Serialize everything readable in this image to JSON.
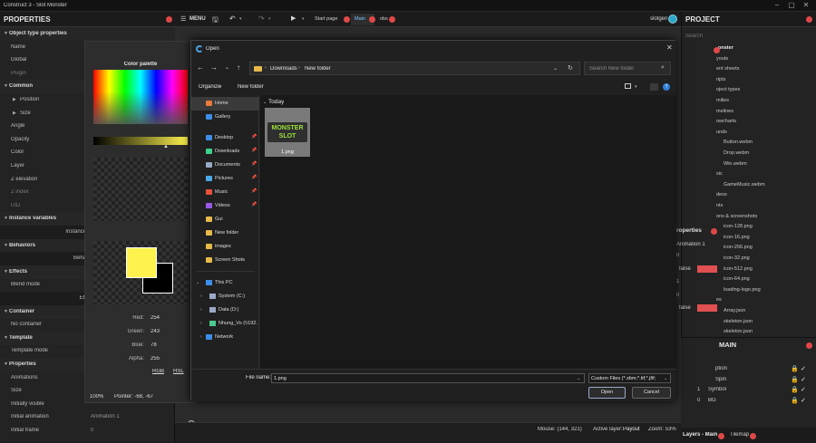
{
  "window": {
    "title": "Construct 3 - Slot Monster"
  },
  "properties": {
    "title": "PROPERTIES",
    "rows": [
      {
        "label": "Object type properties",
        "kind": "sec"
      },
      {
        "label": "Name",
        "kind": "row"
      },
      {
        "label": "Global",
        "kind": "row"
      },
      {
        "label": "Plugin",
        "kind": "dim"
      },
      {
        "label": "Common",
        "kind": "sec"
      },
      {
        "label": "Position",
        "kind": "ind"
      },
      {
        "label": "Size",
        "kind": "ind"
      },
      {
        "label": "Angle",
        "kind": "row"
      },
      {
        "label": "Opacity",
        "kind": "row"
      },
      {
        "label": "Color",
        "kind": "row"
      },
      {
        "label": "Layer",
        "kind": "row"
      },
      {
        "label": "Z elevation",
        "kind": "row"
      },
      {
        "label": "Z index",
        "kind": "dim"
      },
      {
        "label": "UID",
        "kind": "dim"
      },
      {
        "label": "Instance variables",
        "kind": "sec"
      },
      {
        "label": "Instance",
        "kind": "btn"
      },
      {
        "label": "Behaviors",
        "kind": "sec"
      },
      {
        "label": "Beha",
        "kind": "btn"
      },
      {
        "label": "Effects",
        "kind": "sec"
      },
      {
        "label": "Blend mode",
        "kind": "row"
      },
      {
        "label": "Eff",
        "kind": "btn"
      },
      {
        "label": "Container",
        "kind": "sec"
      },
      {
        "label": "No container",
        "kind": "row"
      },
      {
        "label": "Template",
        "kind": "sec"
      },
      {
        "label": "Template mode",
        "kind": "row"
      },
      {
        "label": "Properties",
        "kind": "sec"
      },
      {
        "label": "Animations",
        "kind": "row"
      },
      {
        "label": "Size",
        "kind": "row"
      },
      {
        "label": "Initially visible",
        "kind": "row"
      },
      {
        "label": "Initial animation",
        "kind": "row"
      },
      {
        "label": "Initial frame",
        "kind": "row"
      }
    ],
    "initial_animation_value": "Animation 1",
    "initial_frame_value": "0"
  },
  "toolbar": {
    "menu_label": "MENU",
    "tabs": [
      {
        "label": "Start page"
      },
      {
        "label": "Main"
      },
      {
        "label": "obs"
      }
    ],
    "user": "slotgen"
  },
  "palette": {
    "title": "Color palette",
    "fg_color": "#fef34e",
    "bg_color": "#000000",
    "red_label": "Red:",
    "red": "254",
    "green_label": "Green:",
    "green": "243",
    "blue_label": "Blue:",
    "blue": "78",
    "alpha_label": "Alpha:",
    "alpha": "255",
    "mode_rgb": "RGB",
    "mode_hsl": "HSL",
    "zoom": "100%",
    "pointer": "Pointer: -68, -67"
  },
  "dialog": {
    "title": "Open",
    "breadcrumb": [
      "Downloads",
      "New folder"
    ],
    "search_placeholder": "Search New folder",
    "organize": "Organize",
    "new_folder": "New folder",
    "nav_items": [
      {
        "label": "Home",
        "icon": "home-icon",
        "pinned": false,
        "selected": true
      },
      {
        "label": "Gallery",
        "icon": "gallery-icon",
        "pinned": false
      },
      {
        "label": "Desktop",
        "icon": "desktop-icon",
        "pinned": true
      },
      {
        "label": "Downloads",
        "icon": "downloads-icon",
        "pinned": true
      },
      {
        "label": "Documents",
        "icon": "documents-icon",
        "pinned": true
      },
      {
        "label": "Pictures",
        "icon": "pictures-icon",
        "pinned": true
      },
      {
        "label": "Music",
        "icon": "music-icon",
        "pinned": true
      },
      {
        "label": "Videos",
        "icon": "videos-icon",
        "pinned": true
      },
      {
        "label": "Gui",
        "icon": "folder-icon",
        "pinned": false
      },
      {
        "label": "New folder",
        "icon": "folder-icon",
        "pinned": false
      },
      {
        "label": "images",
        "icon": "folder-icon",
        "pinned": false
      },
      {
        "label": "Screen Shots",
        "icon": "folder-icon",
        "pinned": false
      }
    ],
    "tree_items": [
      {
        "label": "This PC",
        "icon": "pc-icon"
      },
      {
        "label": "System (C:)",
        "icon": "drive-icon"
      },
      {
        "label": "Data (D:)",
        "icon": "drive-icon"
      },
      {
        "label": "Nhung_Vo (\\\\192.",
        "icon": "network-drive-icon"
      },
      {
        "label": "Network",
        "icon": "network-icon"
      }
    ],
    "group_label": "Today",
    "files": [
      {
        "name": "1.png",
        "thumb_text": "MONSTER SLOT"
      }
    ],
    "filename_label": "File name:",
    "filename_value": "1.png",
    "filetype_value": "Custom Files (*.xbm;*.tif;*.jfif;",
    "open_button": "Open",
    "cancel_button": "Cancel"
  },
  "project": {
    "title": "PROJECT",
    "search_placeholder": "Search",
    "items": [
      {
        "label": "onster"
      },
      {
        "label": "youts"
      },
      {
        "label": "ent sheets"
      },
      {
        "label": "ripts"
      },
      {
        "label": "oject types"
      },
      {
        "label": "milies"
      },
      {
        "label": "melines"
      },
      {
        "label": "owcharts"
      },
      {
        "label": "unds"
      },
      {
        "label": "Button.webm"
      },
      {
        "label": "Drop.webm"
      },
      {
        "label": "Win.webm"
      },
      {
        "label": "sic"
      },
      {
        "label": "GameMusic.webm"
      },
      {
        "label": "deos"
      },
      {
        "label": "nts"
      },
      {
        "label": "ons & screenshots"
      },
      {
        "label": "icon-128.png"
      },
      {
        "label": "icon-16.png"
      },
      {
        "label": "icon-256.png"
      },
      {
        "label": "icon-32.png"
      },
      {
        "label": "icon-512.png"
      },
      {
        "label": "icon-64.png"
      },
      {
        "label": "loading-logo.png"
      },
      {
        "label": "es"
      },
      {
        "label": "Array.json"
      },
      {
        "label": "skeleton.json"
      },
      {
        "label": "skeleton.json"
      }
    ],
    "props_title": "roperties",
    "anim_value": "Animation 1",
    "props_values": [
      "0",
      "false",
      "1",
      "0",
      "false"
    ]
  },
  "layers": {
    "title": "MAIN",
    "rows": [
      {
        "label": "ption"
      },
      {
        "label": "Spin"
      },
      {
        "label": "Symbol"
      },
      {
        "label": "BG"
      }
    ],
    "row_nums": [
      "1",
      "0"
    ],
    "tab_main": "Layers - Main",
    "tab_tilemap": "Tilemap"
  },
  "status": {
    "mouse": "Mouse: (144, 321)",
    "active_layer": "Active layer:",
    "active_layer_value": "Payout",
    "zoom": "Zoom: 53%"
  }
}
